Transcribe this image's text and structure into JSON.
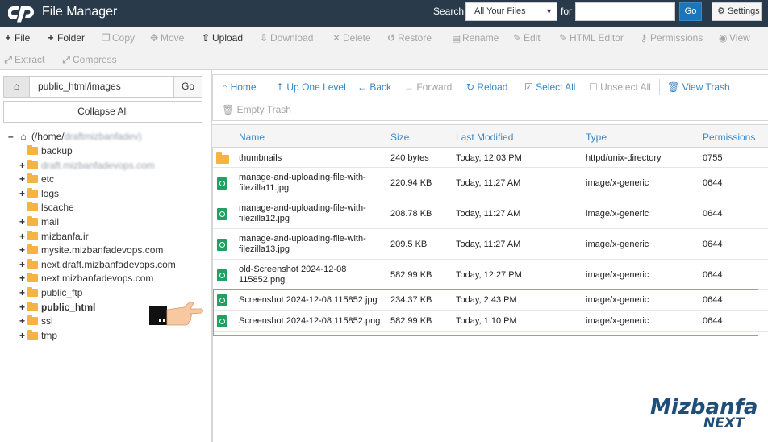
{
  "header": {
    "title": "File Manager",
    "search_label": "Search",
    "search_scope": "All Your Files",
    "for_label": "for",
    "search_value": "",
    "go_label": "Go",
    "settings_label": "Settings"
  },
  "toolbar": {
    "items": [
      {
        "label": "File",
        "icon": "plus-icon",
        "enabled": true
      },
      {
        "label": "Folder",
        "icon": "plus-icon",
        "enabled": true
      },
      {
        "label": "Copy",
        "icon": "copy-icon",
        "enabled": false
      },
      {
        "label": "Move",
        "icon": "move-icon",
        "enabled": false
      },
      {
        "label": "Upload",
        "icon": "upload-icon",
        "enabled": true
      },
      {
        "label": "Download",
        "icon": "download-icon",
        "enabled": false
      },
      {
        "label": "Delete",
        "icon": "x-icon",
        "enabled": false
      },
      {
        "label": "Restore",
        "icon": "undo-icon",
        "enabled": false
      },
      {
        "label": "Rename",
        "icon": "file-icon",
        "enabled": false
      },
      {
        "label": "Edit",
        "icon": "pencil-icon",
        "enabled": false
      },
      {
        "label": "HTML Editor",
        "icon": "pencil-icon",
        "enabled": false
      },
      {
        "label": "Permissions",
        "icon": "key-icon",
        "enabled": false
      },
      {
        "label": "View",
        "icon": "eye-icon",
        "enabled": false
      },
      {
        "label": "Extract",
        "icon": "expand-icon",
        "enabled": false
      },
      {
        "label": "Compress",
        "icon": "compress-icon",
        "enabled": false
      }
    ]
  },
  "left": {
    "path_value": "public_html/images",
    "go_label": "Go",
    "collapse_label": "Collapse All",
    "root_label": "(/home/",
    "root_user": "draftmizbanfadev)",
    "tree": [
      {
        "label": "backup",
        "toggle": ""
      },
      {
        "label": "draft.mizbanfadevops.com",
        "toggle": "+",
        "blurred": true
      },
      {
        "label": "etc",
        "toggle": "+"
      },
      {
        "label": "logs",
        "toggle": "+"
      },
      {
        "label": "lscache",
        "toggle": ""
      },
      {
        "label": "mail",
        "toggle": "+"
      },
      {
        "label": "mizbanfa.ir",
        "toggle": "+"
      },
      {
        "label": "mysite.mizbanfadevops.com",
        "toggle": "+"
      },
      {
        "label": "next.draft.mizbanfadevops.com",
        "toggle": "+"
      },
      {
        "label": "next.mizbanfadevops.com",
        "toggle": "+"
      },
      {
        "label": "public_ftp",
        "toggle": "+"
      },
      {
        "label": "public_html",
        "toggle": "+",
        "bold": true
      },
      {
        "label": "ssl",
        "toggle": "+"
      },
      {
        "label": "tmp",
        "toggle": "+"
      }
    ]
  },
  "nav": {
    "home": "Home",
    "up": "Up One Level",
    "back": "Back",
    "forward": "Forward",
    "reload": "Reload",
    "select_all": "Select All",
    "unselect_all": "Unselect All",
    "view_trash": "View Trash",
    "empty_trash": "Empty Trash"
  },
  "table": {
    "columns": [
      "Name",
      "Size",
      "Last Modified",
      "Type",
      "Permissions"
    ],
    "rows": [
      {
        "name1": "thumbnails",
        "name2": "",
        "size": "240 bytes",
        "modified": "Today, 12:03 PM",
        "type": "httpd/unix-directory",
        "perms": "0755",
        "kind": "folder"
      },
      {
        "name1": "manage-and-uploading-file-with-",
        "name2": "filezilla11.jpg",
        "size": "220.94 KB",
        "modified": "Today, 11:27 AM",
        "type": "image/x-generic",
        "perms": "0644",
        "kind": "image"
      },
      {
        "name1": "manage-and-uploading-file-with-",
        "name2": "filezilla12.jpg",
        "size": "208.78 KB",
        "modified": "Today, 11:27 AM",
        "type": "image/x-generic",
        "perms": "0644",
        "kind": "image"
      },
      {
        "name1": "manage-and-uploading-file-with-",
        "name2": "filezilla13.jpg",
        "size": "209.5 KB",
        "modified": "Today, 11:27 AM",
        "type": "image/x-generic",
        "perms": "0644",
        "kind": "image"
      },
      {
        "name1": "old-Screenshot 2024-12-08",
        "name2": "115852.png",
        "size": "582.99 KB",
        "modified": "Today, 12:27 PM",
        "type": "image/x-generic",
        "perms": "0644",
        "kind": "image"
      },
      {
        "name1": "Screenshot 2024-12-08 115852.jpg",
        "name2": "",
        "size": "234.37 KB",
        "modified": "Today, 2:43 PM",
        "type": "image/x-generic",
        "perms": "0644",
        "kind": "image"
      },
      {
        "name1": "Screenshot 2024-12-08 115852.png",
        "name2": "",
        "size": "582.99 KB",
        "modified": "Today, 1:10 PM",
        "type": "image/x-generic",
        "perms": "0644",
        "kind": "image"
      }
    ]
  },
  "watermark": {
    "brand": "Mizbanfa",
    "sub": "NEXT"
  },
  "colors": {
    "header_bg": "#293a4a",
    "link": "#3a87c7",
    "folder": "#f6b343",
    "file": "#22a062",
    "highlight": "#7ac043"
  }
}
